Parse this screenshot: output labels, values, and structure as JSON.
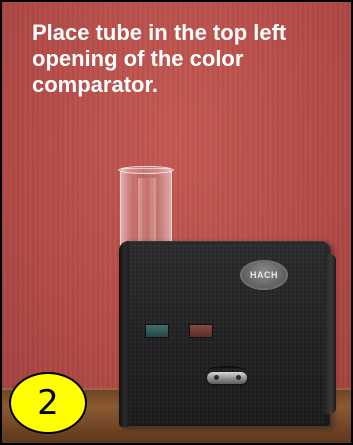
{
  "instruction": {
    "text": "Place tube in the top left opening of the color comparator."
  },
  "device": {
    "brand": "HACH"
  },
  "step": {
    "number": "2"
  },
  "colors": {
    "wall": "#b9504c",
    "text": "#ffffff",
    "comparator": "#222224",
    "badge": "#ffff00"
  }
}
